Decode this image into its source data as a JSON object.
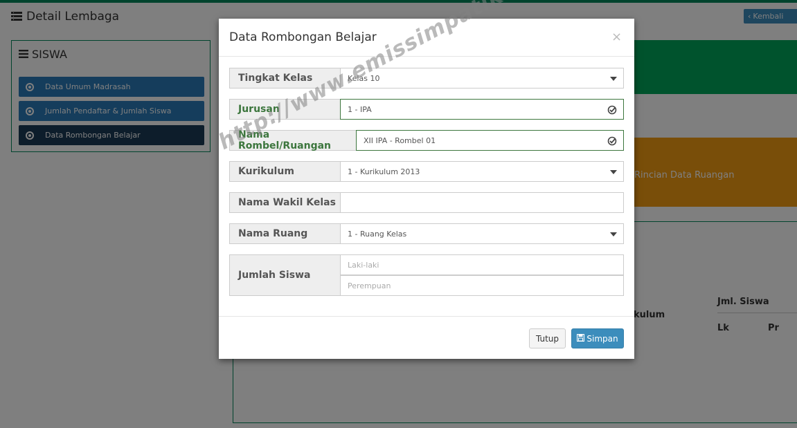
{
  "page": {
    "title": "Detail Lembaga",
    "back_button": "Kembali"
  },
  "sidebar": {
    "title": "SISWA",
    "items": [
      {
        "label": "Data Umum Madrasah"
      },
      {
        "label": "Jumlah Pendaftar & Jumlah Siswa"
      },
      {
        "label": "Data Rombongan Belajar"
      }
    ]
  },
  "background": {
    "orange_text": "Rincian Data Ruangan",
    "table_headers": {
      "kurikulum": "kulum",
      "jml_siswa": "Jml. Siswa",
      "lk": "Lk",
      "pr": "Pr"
    }
  },
  "modal": {
    "title": "Data Rombongan Belajar",
    "close": "×",
    "fields": {
      "tingkat_kelas": {
        "label": "Tingkat Kelas",
        "value": "Kelas 10"
      },
      "jurusan": {
        "label": "Jurusan",
        "value": "1 - IPA"
      },
      "nama_rombel": {
        "label": "Nama Rombel/Ruangan",
        "value": "XII IPA - Rombel 01"
      },
      "kurikulum": {
        "label": "Kurikulum",
        "value": "1 - Kurikulum 2013"
      },
      "nama_wakil": {
        "label": "Nama Wakil Kelas",
        "value": ""
      },
      "nama_ruang": {
        "label": "Nama Ruang",
        "value": "1 - Ruang Kelas"
      },
      "jumlah_siswa": {
        "label": "Jumlah Siswa",
        "laki_placeholder": "Laki-laki",
        "perempuan_placeholder": "Perempuan"
      }
    },
    "buttons": {
      "tutup": "Tutup",
      "simpan": "Simpan"
    }
  },
  "watermark": "http://www.emissimpatikazone.com",
  "watermark_mark": "®",
  "colors": {
    "green": "#00a65a",
    "orange": "#f39c12",
    "primary": "#3c8dbc",
    "success_text": "#3c763d"
  }
}
